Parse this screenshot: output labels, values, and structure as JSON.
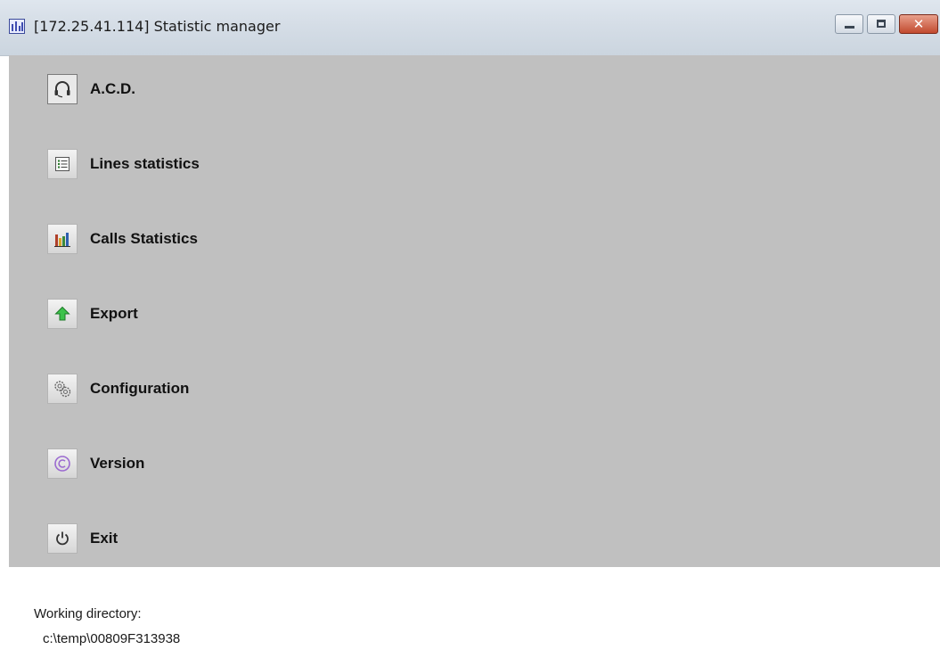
{
  "window": {
    "title": "[172.25.41.114] Statistic manager"
  },
  "menu": {
    "items": [
      {
        "label": "A.C.D.",
        "icon": "headset-icon"
      },
      {
        "label": "Lines statistics",
        "icon": "list-icon"
      },
      {
        "label": "Calls Statistics",
        "icon": "bar-chart-icon"
      },
      {
        "label": "Export",
        "icon": "arrow-up-icon"
      },
      {
        "label": "Configuration",
        "icon": "gears-icon"
      },
      {
        "label": "Version",
        "icon": "copyright-icon"
      },
      {
        "label": "Exit",
        "icon": "power-icon"
      }
    ]
  },
  "footer": {
    "working_directory_label": "Working directory:",
    "working_directory_path": "c:\\temp\\00809F313938"
  },
  "colors": {
    "menu_background": "#c0c0c0",
    "window_background": "#ffffff",
    "close_button": "#c24a2f"
  }
}
